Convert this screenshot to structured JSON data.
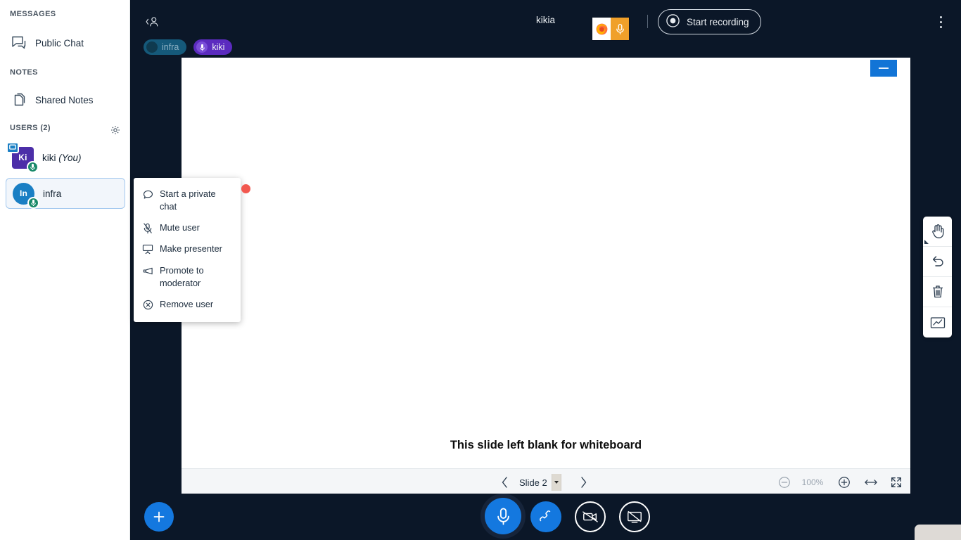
{
  "sidebar": {
    "messages_heading": "MESSAGES",
    "public_chat_label": "Public Chat",
    "notes_heading": "NOTES",
    "shared_notes_label": "Shared Notes",
    "users_heading": "USERS (2)",
    "users": [
      {
        "initials": "Ki",
        "name": "kiki",
        "suffix": "(You)",
        "avatar_color": "#4c2ea8",
        "shape": "square",
        "presenter": true,
        "muted_badge": "mic"
      },
      {
        "initials": "In",
        "name": "infra",
        "suffix": "",
        "avatar_color": "#1a7fc4",
        "shape": "circle",
        "presenter": false,
        "muted_badge": "mic"
      }
    ]
  },
  "topbar": {
    "hide_users_icon": "hide-user-list-icon",
    "meeting_title": "kikia",
    "start_recording_label": "Start recording",
    "options_icon": "vertical-dots-icon",
    "firefox_permission": {
      "browser_icon": "firefox-icon",
      "mic_icon": "microphone-icon"
    }
  },
  "chips": [
    {
      "label": "infra",
      "icon": "avatar-dot-icon",
      "color": "#15597a"
    },
    {
      "label": "kiki",
      "icon": "microphone-icon",
      "color": "#5b2bbf"
    }
  ],
  "presentation": {
    "slide_text": "This slide left blank for whiteboard",
    "minimize_icon": "minimize-icon",
    "footer": {
      "prev_icon": "chevron-left-icon",
      "next_icon": "chevron-right-icon",
      "slide_label": "Slide 2",
      "zoom_out_icon": "zoom-out-icon",
      "zoom_level": "100%",
      "zoom_in_icon": "zoom-in-icon",
      "fit_width_icon": "fit-to-width-icon",
      "fullscreen_icon": "fullscreen-icon"
    }
  },
  "whiteboard_tools": [
    {
      "name": "pan-tool",
      "icon": "hand-icon"
    },
    {
      "name": "undo-tool",
      "icon": "undo-arrow-icon"
    },
    {
      "name": "delete-tool",
      "icon": "trash-icon"
    },
    {
      "name": "multi-user-whiteboard",
      "icon": "whiteboard-icon"
    }
  ],
  "actions": {
    "add_label": "+",
    "mic": {
      "name": "mute-toggle",
      "icon": "microphone-icon",
      "state": "unmuted"
    },
    "leave": {
      "name": "leave-audio",
      "icon": "phone-icon"
    },
    "camera": {
      "name": "share-webcam",
      "icon": "camera-off-icon"
    },
    "screen": {
      "name": "share-screen",
      "icon": "screen-off-icon"
    }
  },
  "context_menu": {
    "items": [
      {
        "label": "Start a private chat",
        "icon": "chat-bubble-icon"
      },
      {
        "label": "Mute user",
        "icon": "mic-off-icon"
      },
      {
        "label": "Make presenter",
        "icon": "presentation-screen-icon"
      },
      {
        "label": "Promote to moderator",
        "icon": "megaphone-icon"
      },
      {
        "label": "Remove user",
        "icon": "remove-circle-icon"
      }
    ]
  },
  "colors": {
    "accent": "#1478df",
    "dark_bg": "#0b1728",
    "selected_user_bg": "#f2f6fb",
    "cursor": "#f2584f"
  }
}
